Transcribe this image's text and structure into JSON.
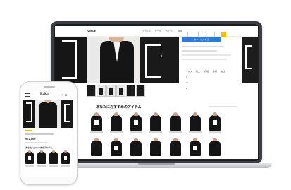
{
  "desktop": {
    "logo": "Vogue",
    "nav": [
      "ブランド",
      "セール",
      "カテゴリ",
      "特集"
    ],
    "cart_button": "カートに入れる",
    "size_headers": [
      "サイズ",
      "着丈",
      "肩幅",
      "身幅",
      "袖丈"
    ],
    "size_rows": [
      [
        "S",
        "M",
        "L"
      ]
    ],
    "recommended_title": "あなたにおすすめのアイテム"
  },
  "mobile": {
    "logo": "Rakh",
    "price": "¥72,000",
    "recommended_title": "あなたにおすすめのアイテム",
    "header_icons": "♡ ⊡"
  },
  "colors": {
    "accent_blue": "#2f7bd4",
    "accent_yellow": "#f6c000",
    "product_black": "#151515"
  }
}
